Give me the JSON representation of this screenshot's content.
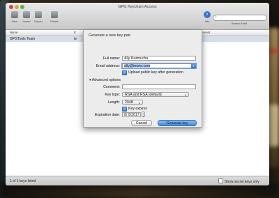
{
  "window": {
    "title": "GPG Keychain Access"
  },
  "toolbar": {
    "buttons": [
      {
        "label": "New",
        "icon": "new-key-icon"
      },
      {
        "label": "Import",
        "icon": "import-icon"
      },
      {
        "label": "Export",
        "icon": "export-icon"
      },
      {
        "label": "Delete",
        "icon": "delete-icon"
      }
    ],
    "info_label": "Info",
    "info_glyph": "i",
    "search_placeholder": "",
    "search_label": "Search Field"
  },
  "table": {
    "columns": [
      "Name",
      "E",
      "Comment"
    ],
    "rows": [
      {
        "name": "GPGTools Team",
        "email": "te"
      }
    ]
  },
  "status": {
    "text": "1 of 1 keys listed",
    "show_secret_label": "Show secret keys only",
    "show_secret_checked": false
  },
  "dialog": {
    "title": "Generate a new key pair.",
    "full_name_label": "Full name:",
    "full_name_value": "Ally Kazmucha",
    "email_label": "Email address:",
    "email_value": "ally@imore.com",
    "upload_label": "Upload public key after generation",
    "upload_checked": true,
    "advanced_label": "Advanced options",
    "comment_label": "Comment:",
    "comment_value": "",
    "key_type_label": "Key type:",
    "key_type_value": "RSA and RSA (default)",
    "length_label": "Length:",
    "length_value": "2048",
    "key_expires_label": "Key expires",
    "key_expires_checked": true,
    "expiration_label": "Expiration date:",
    "expiration_value": "8/ 9/2017",
    "cancel_label": "Cancel",
    "generate_label": "Generate key"
  },
  "colors": {
    "accent": "#3f86df",
    "selection": "#d5deea"
  }
}
